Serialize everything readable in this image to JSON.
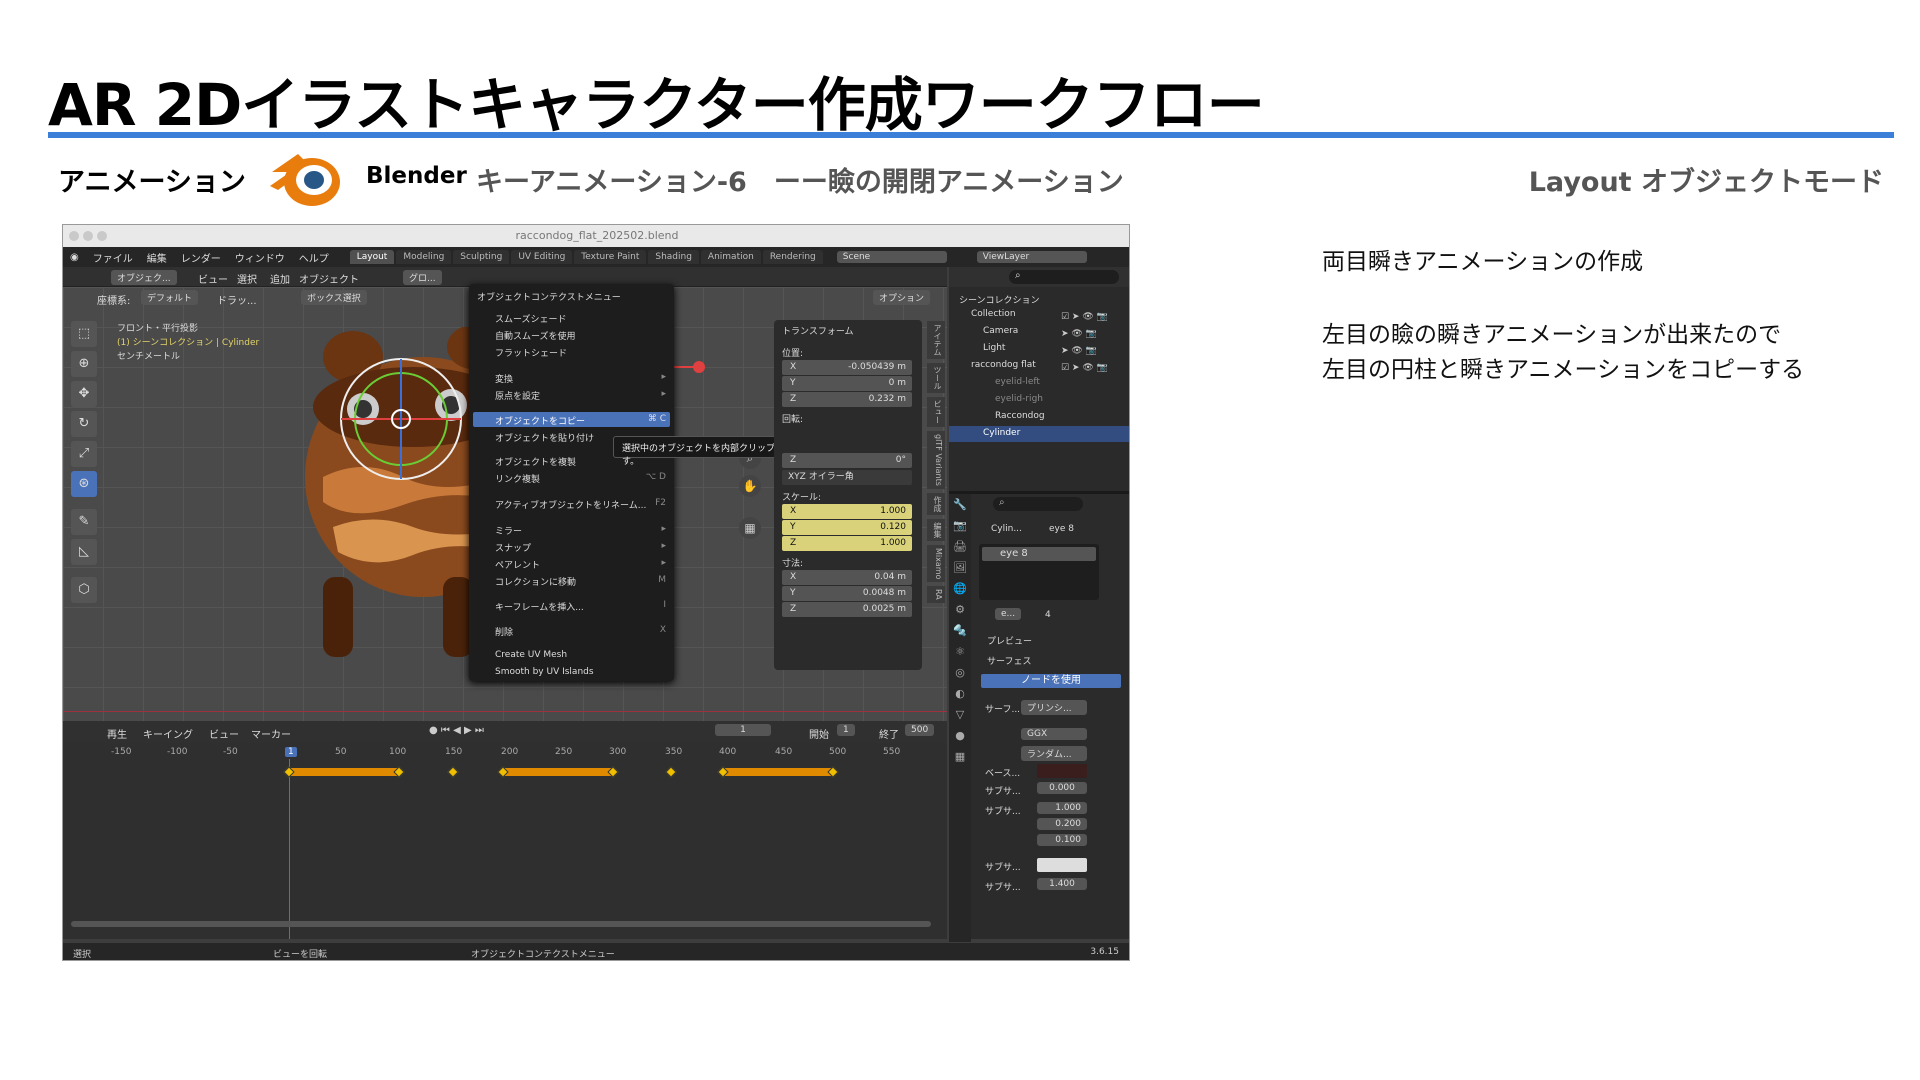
{
  "title": "AR 2Dイラストキャラクター作成ワークフロー",
  "header": {
    "section": "アニメーション",
    "app": "Blender",
    "step": "キーアニメーション-6　ーー瞼の開閉アニメーション",
    "mode": "Layout オブジェクトモード"
  },
  "notes": {
    "line1": "両目瞬きアニメーションの作成",
    "line2": "左目の瞼の瞬きアニメーションが出来たので",
    "line3": "左目の円柱と瞬きアニメーションをコピーする"
  },
  "blender": {
    "window_title": "raccondog_flat_202502.blend",
    "menu": [
      "ファイル",
      "編集",
      "レンダー",
      "ウィンドウ",
      "ヘルプ"
    ],
    "workspaces": [
      "Layout",
      "Modeling",
      "Sculpting",
      "UV Editing",
      "Texture Paint",
      "Shading",
      "Animation",
      "Rendering"
    ],
    "scene": "Scene",
    "view_layer": "ViewLayer",
    "viewport_header": {
      "mode": "オブジェク...",
      "menus": [
        "ビュー",
        "選択",
        "追加",
        "オブジェクト"
      ],
      "orient_label": "座標系:",
      "orient": "デフォルト",
      "drag": "ドラッ...",
      "select": "ボックス選択",
      "options": "オプション",
      "transform": "グロ..."
    },
    "viewport_info": {
      "view": "フロント・平行投影",
      "collection": "(1) シーンコレクション | Cylinder",
      "unit": "センチメートル"
    },
    "context_menu": {
      "title": "オブジェクトコンテクストメニュー",
      "items": [
        {
          "label": "スムーズシェード",
          "key": ""
        },
        {
          "label": "自動スムーズを使用",
          "key": ""
        },
        {
          "label": "フラットシェード",
          "key": ""
        },
        {
          "label": "変換",
          "key": "▸"
        },
        {
          "label": "原点を設定",
          "key": "▸"
        },
        {
          "label": "オブジェクトをコピー",
          "key": "⌘ C"
        },
        {
          "label": "オブジェクトを貼り付け",
          "key": ""
        },
        {
          "label": "オブジェクトを複製",
          "key": ""
        },
        {
          "label": "リンク複製",
          "key": "⌥ D"
        },
        {
          "label": "アクティブオブジェクトをリネーム...",
          "key": "F2"
        },
        {
          "label": "ミラー",
          "key": "▸"
        },
        {
          "label": "スナップ",
          "key": "▸"
        },
        {
          "label": "ペアレント",
          "key": "▸"
        },
        {
          "label": "コレクションに移動",
          "key": "M"
        },
        {
          "label": "キーフレームを挿入...",
          "key": "I"
        },
        {
          "label": "削除",
          "key": "X"
        },
        {
          "label": "Create UV Mesh",
          "key": ""
        },
        {
          "label": "Smooth by UV Islands",
          "key": ""
        }
      ]
    },
    "tooltip": "選択中のオブジェクトを内部クリップボードにコピーします。",
    "transform": {
      "title": "トランスフォーム",
      "location_label": "位置:",
      "location": [
        {
          "axis": "X",
          "value": "-0.050439 m"
        },
        {
          "axis": "Y",
          "value": "0 m"
        },
        {
          "axis": "Z",
          "value": "0.232 m"
        }
      ],
      "rotation_label": "回転:",
      "rotation_z": {
        "axis": "Z",
        "value": "0°"
      },
      "rotation_mode": "XYZ オイラー角",
      "scale_label": "スケール:",
      "scale": [
        {
          "axis": "X",
          "value": "1.000"
        },
        {
          "axis": "Y",
          "value": "0.120"
        },
        {
          "axis": "Z",
          "value": "1.000"
        }
      ],
      "dimensions_label": "寸法:",
      "dimensions": [
        {
          "axis": "X",
          "value": "0.04 m"
        },
        {
          "axis": "Y",
          "value": "0.0048 m"
        },
        {
          "axis": "Z",
          "value": "0.0025 m"
        }
      ]
    },
    "side_tabs": [
      "アイテム",
      "ツール",
      "ビュー",
      "glTF Variants",
      "作成",
      "編集",
      "Mixamo",
      "RA"
    ],
    "timeline": {
      "menus": [
        "再生",
        "キーイング",
        "ビュー",
        "マーカー"
      ],
      "current_frame": "1",
      "start_label": "開始",
      "start": "1",
      "end_label": "終了",
      "end": "500",
      "ticks": [
        "-150",
        "-100",
        "-50",
        "1",
        "50",
        "100",
        "150",
        "200",
        "250",
        "300",
        "350",
        "400",
        "450",
        "500",
        "550"
      ]
    },
    "status": {
      "select": "選択",
      "rotate": "ビューを回転",
      "menu": "オブジェクトコンテクストメニュー",
      "version": "3.6.15"
    },
    "outliner": {
      "root": "シーンコレクション",
      "items": [
        "Collection",
        "Camera",
        "Light",
        "raccondog flat",
        "eyelid-left",
        "eyelid-righ",
        "Raccondog",
        "Cylinder"
      ]
    },
    "properties": {
      "breadcrumb_obj": "Cylin...",
      "breadcrumb_mat": "eye 8",
      "material_slot": "eye 8",
      "mat_name": "e...",
      "users": "4",
      "preview": "プレビュー",
      "surface_section": "サーフェス",
      "use_nodes": "ノードを使用",
      "surface_label": "サーフ...",
      "surface_value": "プリンシ...",
      "dist": "GGX",
      "sss": "ランダム...",
      "base_label": "ベース...",
      "sub1_label": "サブサ...",
      "sub1_value": "0.000",
      "sub2_label": "サブサ...",
      "radius": [
        "1.000",
        "0.200",
        "0.100"
      ],
      "sub3_label": "サブサ...",
      "sub4_label": "サブサ...",
      "sub4_value": "1.400"
    }
  },
  "colors": {
    "accent": "#3b7fd9",
    "select": "#4a72b8",
    "key": "#e08a00"
  }
}
